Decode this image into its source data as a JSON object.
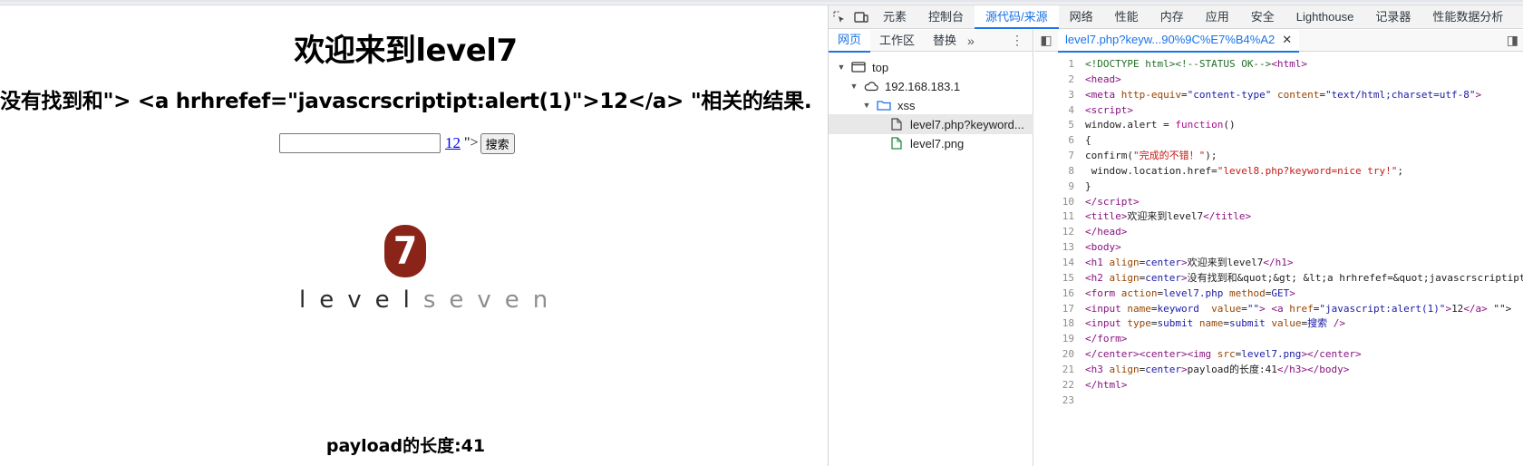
{
  "page": {
    "h1": "欢迎来到level7",
    "h2": "没有找到和\"> <a hrhrefef=\"javascrscriptipt:alert(1)\">12</a> \"相关的结果.",
    "input_value": "",
    "link_text": "12",
    "after_link": "\">",
    "submit_label": "搜索",
    "logo": {
      "number": "7",
      "word_a": "level",
      "word_b": "seven",
      "badge_color": "#8a2419"
    },
    "h3": "payload的长度:41"
  },
  "devtools": {
    "tabs": [
      "元素",
      "控制台",
      "源代码/来源",
      "网络",
      "性能",
      "内存",
      "应用",
      "安全",
      "Lighthouse",
      "记录器",
      "性能数据分析"
    ],
    "active_tab": "源代码/来源",
    "accent": "#1a73e8",
    "navigator": {
      "sub_tabs": [
        "网页",
        "工作区",
        "替换"
      ],
      "tree": [
        {
          "label": "top",
          "icon": "frame-icon",
          "expanded": true
        },
        {
          "label": "192.168.183.1",
          "icon": "cloud-icon",
          "expanded": true
        },
        {
          "label": "xss",
          "icon": "folder-icon",
          "expanded": true
        },
        {
          "label": "level7.php?keyword...",
          "icon": "file-icon",
          "selected": true
        },
        {
          "label": "level7.png",
          "icon": "image-file-icon"
        }
      ]
    },
    "editor": {
      "tab_label": "level7.php?keyw...90%9C%E7%B4%A2",
      "line_numbers": [
        "1",
        "2",
        "3",
        "4",
        "5",
        "6",
        "7",
        "8",
        "9",
        "10",
        "11",
        "12",
        "13",
        "14",
        "15",
        "16",
        "17",
        "18",
        "19",
        "20",
        "21",
        "22",
        "23"
      ]
    }
  }
}
